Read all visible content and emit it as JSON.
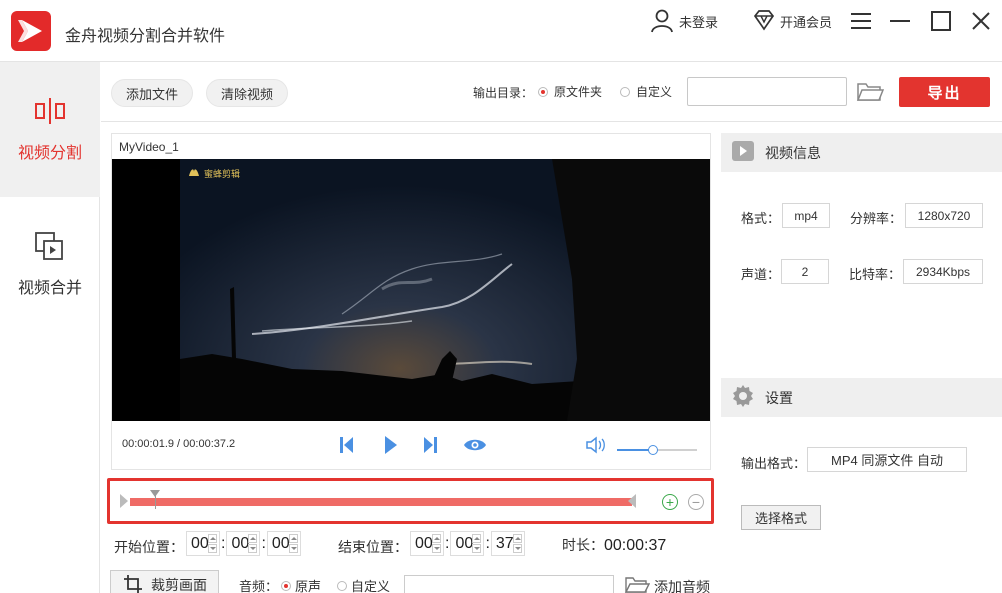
{
  "app": {
    "title": "金舟视频分割合并软件"
  },
  "header": {
    "login_label": "未登录",
    "vip_label": "开通会员"
  },
  "sidebar": {
    "items": [
      {
        "label": "视频分割"
      },
      {
        "label": "视频合并"
      }
    ]
  },
  "toolbar": {
    "add_file": "添加文件",
    "clear_video": "清除视频",
    "output_dir_label": "输出目录：",
    "output_options": [
      {
        "label": "原文件夹",
        "checked": true
      },
      {
        "label": "自定义",
        "checked": false
      }
    ],
    "output_path": "",
    "export_label": "导出"
  },
  "video": {
    "name": "MyVideo_1",
    "watermark": "蜜蜂剪辑",
    "time_display": "00:00:01.9 / 00:00:37.2",
    "volume_level": 0.45
  },
  "timeline": {
    "playhead_fraction": 0.05,
    "zoom_in": "+",
    "zoom_out": "−"
  },
  "trim": {
    "start_label": "开始位置：",
    "start": [
      "00",
      "00",
      "00"
    ],
    "end_label": "结束位置：",
    "end": [
      "00",
      "00",
      "37"
    ],
    "duration_label": "时长：",
    "duration": "00:00:37"
  },
  "bottom": {
    "crop_label": "裁剪画面",
    "audio_label": "音频：",
    "audio_options": [
      {
        "label": "原声",
        "checked": true
      },
      {
        "label": "自定义",
        "checked": false
      }
    ],
    "audio_path": "",
    "add_audio": "添加音频"
  },
  "info": {
    "title": "视频信息",
    "format_label": "格式：",
    "format": "mp4",
    "resolution_label": "分辨率：",
    "resolution": "1280x720",
    "channels_label": "声道：",
    "channels": "2",
    "bitrate_label": "比特率：",
    "bitrate": "2934Kbps"
  },
  "settings": {
    "title": "设置",
    "output_format_label": "输出格式：",
    "output_format": "MP4 同源文件 自动",
    "choose_format": "选择格式"
  },
  "colors": {
    "accent": "#e3342f",
    "timeline": "#ef6b66",
    "control_blue": "#4a90e2"
  }
}
